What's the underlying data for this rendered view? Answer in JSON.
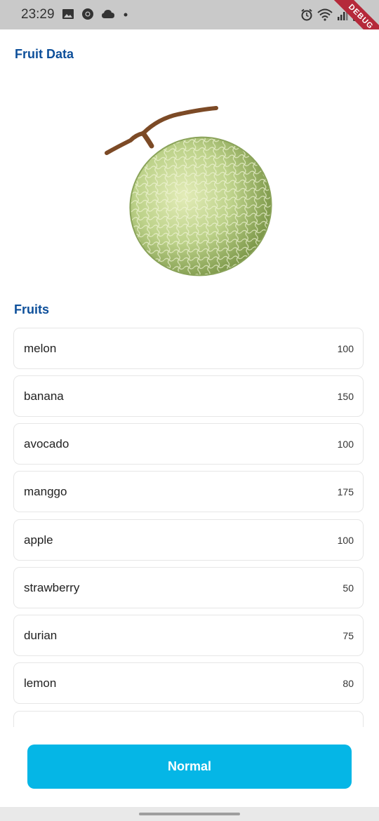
{
  "status_bar": {
    "time": "23:29",
    "left_icons": [
      "image-icon",
      "chrome-icon",
      "cloud-icon",
      "dot-icon"
    ],
    "right_icons": [
      "alarm-icon",
      "wifi-icon",
      "signal-icon",
      "battery-icon"
    ],
    "debug_label": "DEBUG"
  },
  "app": {
    "title": "Fruit Data",
    "image_icon": "melon-image"
  },
  "fruits": {
    "section_title": "Fruits",
    "items": [
      {
        "name": "melon",
        "qty": "100"
      },
      {
        "name": "banana",
        "qty": "150"
      },
      {
        "name": "avocado",
        "qty": "100"
      },
      {
        "name": "manggo",
        "qty": "175"
      },
      {
        "name": "apple",
        "qty": "100"
      },
      {
        "name": "strawberry",
        "qty": "50"
      },
      {
        "name": "durian",
        "qty": "75"
      },
      {
        "name": "lemon",
        "qty": "80"
      },
      {
        "name": "",
        "qty": ""
      }
    ]
  },
  "button": {
    "label": "Normal",
    "color": "#05b6e6"
  },
  "colors": {
    "title": "#0d4f9a",
    "debug_ribbon": "#b5293a"
  }
}
